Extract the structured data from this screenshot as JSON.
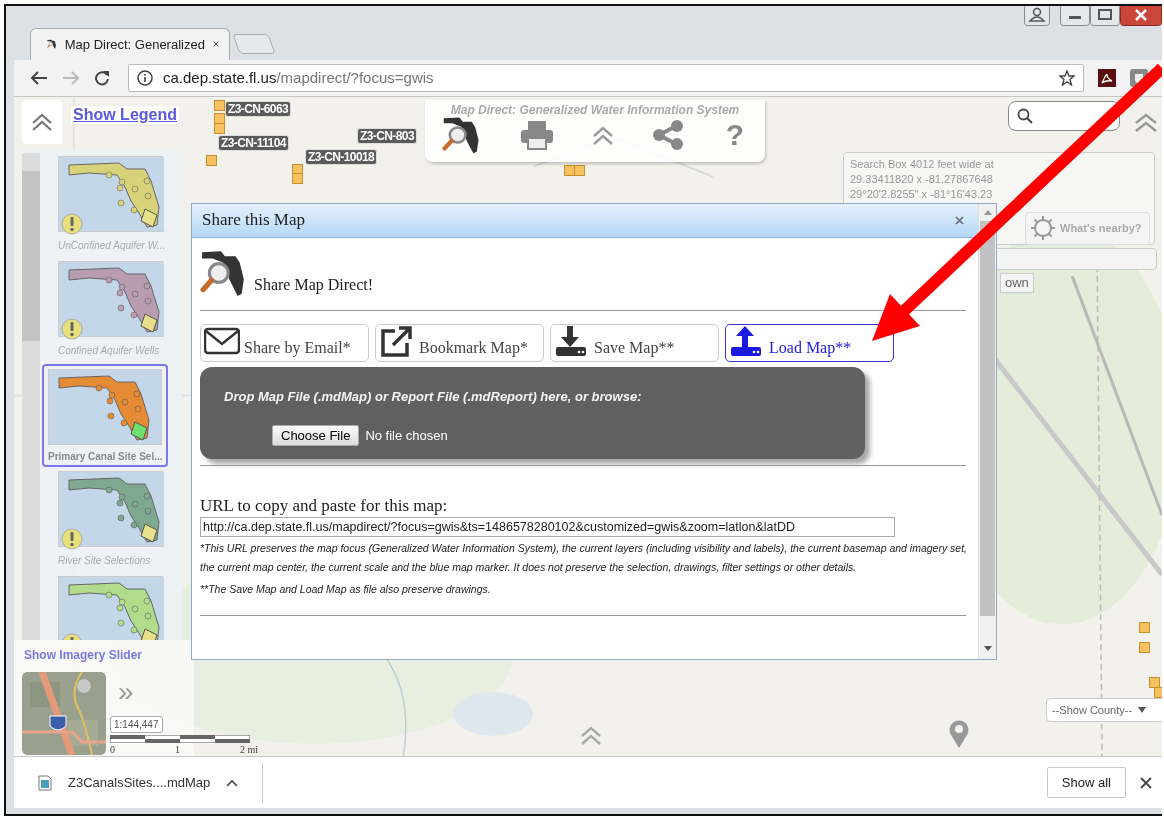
{
  "browser": {
    "tab_title": "Map Direct: Generalized",
    "url_host": "ca.dep.state.fl.us",
    "url_path": "/mapdirect/?focus=gwis"
  },
  "map": {
    "legend_link": "Show Legend",
    "feature_labels": [
      "Z3-CN-6063",
      "Z3-CN-11104",
      "Z3-CN-803",
      "Z3-CN-10018"
    ],
    "layers": [
      {
        "caption": "UnConfined Aquifer W...",
        "selected": false,
        "warning": true
      },
      {
        "caption": "Confined Aquifer Wells",
        "selected": false,
        "warning": true
      },
      {
        "caption": "Primary Canal Site Sel...",
        "selected": true,
        "warning": false
      },
      {
        "caption": "River Site Selections",
        "selected": false,
        "warning": true
      },
      {
        "selected": false,
        "warning": true
      }
    ],
    "imagery_link": "Show Imagery Slider",
    "imagery_expand": "»",
    "scale": "1:144,447",
    "scale_labels": [
      "0",
      "1",
      "2 mi"
    ],
    "toolbar": {
      "title": "Map Direct: Generalized Water Information System",
      "help": "?"
    },
    "search_info": [
      "Search Box 4012 feet wide at",
      "29.33411820 x -81.27867648",
      "29°20'2.8255\" x -81°16'43.23"
    ],
    "nearby_button": "What's nearby?",
    "partial_button": "own",
    "county_select": "--Show County--"
  },
  "dialog": {
    "title": "Share this Map",
    "heading": "Share Map Direct!",
    "actions": [
      {
        "kind": "email",
        "label": "Share by Email*",
        "selected": false
      },
      {
        "kind": "bookmark",
        "label": "Bookmark Map*",
        "selected": false
      },
      {
        "kind": "save",
        "label": "Save Map**",
        "selected": false
      },
      {
        "kind": "load",
        "label": "Load Map**",
        "selected": true
      }
    ],
    "drop_prompt": "Drop Map File (.mdMap) or Report File (.mdReport) here, or browse:",
    "file_button": "Choose File",
    "file_status": "No file chosen",
    "url_label": "URL to copy and paste for this map:",
    "url": "http://ca.dep.state.fl.us/mapdirect/?focus=gwis&ts=1486578280102&customized=gwis&zoom=latlon&latDD",
    "notes": [
      "*This URL preserves the map focus (Generalized Water Information System), the current layers (including visibility and labels), the current basemap and imagery set, the current map center, the current scale and the blue map marker. It does not preserve the selection, drawings, filter settings or other details.",
      "**The Save Map and Load Map as file also preserve drawings."
    ]
  },
  "annotation": {
    "kind": "arrow"
  },
  "downloads": {
    "file": "Z3CanalsSites....mdMap",
    "show_all": "Show all"
  }
}
